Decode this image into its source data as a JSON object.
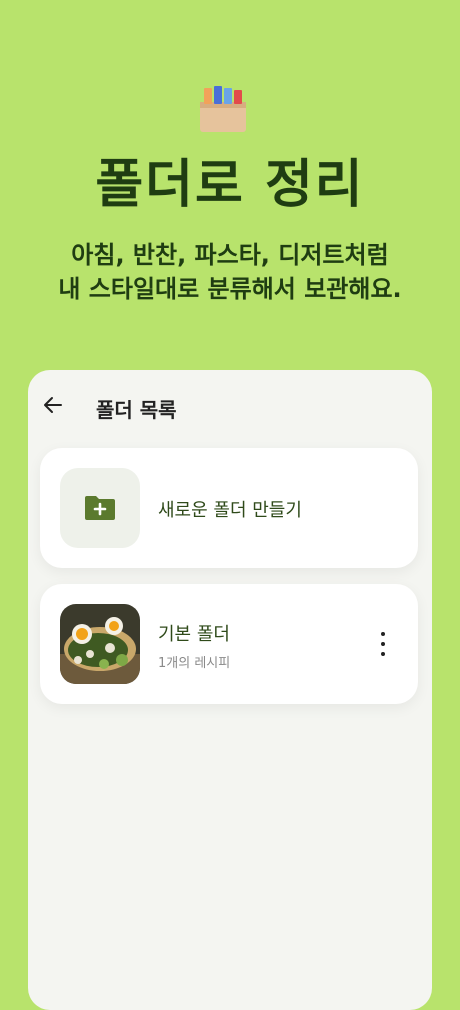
{
  "hero": {
    "icon": "folder-box-icon",
    "title": "폴더로 정리",
    "subtitle_line1": "아침, 반찬, 파스타, 디저트처럼",
    "subtitle_line2": "내 스타일대로 분류해서 보관해요."
  },
  "panel": {
    "back_icon": "arrow-left-icon",
    "title": "폴더 목록",
    "new_folder": {
      "icon": "folder-plus-icon",
      "label": "새로운 폴더 만들기"
    },
    "folders": [
      {
        "name": "기본 폴더",
        "count_label": "1개의 레시피",
        "menu_icon": "more-vertical-icon"
      }
    ]
  },
  "colors": {
    "background": "#b8e36c",
    "title_text": "#1f3d12",
    "accent": "#5b7a2e"
  }
}
